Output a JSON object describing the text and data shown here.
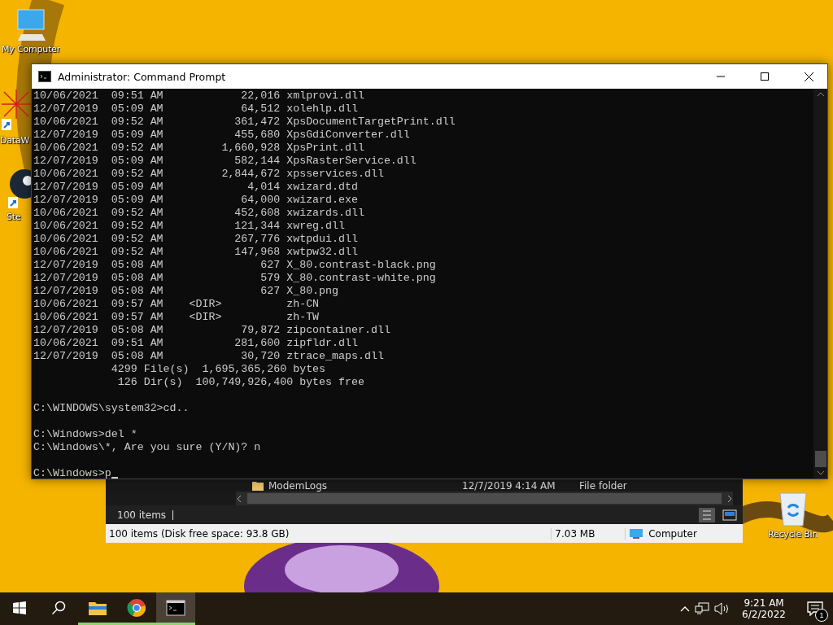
{
  "desktop": {
    "icons": [
      {
        "label": "My Computer",
        "kind": "computer"
      },
      {
        "label": "DataW",
        "kind": "spider"
      },
      {
        "label": "Ste",
        "kind": "steam"
      }
    ],
    "recycle_bin": {
      "label": "Recycle Bin"
    }
  },
  "explorer": {
    "row": {
      "name": "ModemLogs",
      "date": "12/7/2019 4:14 AM",
      "type": "File folder"
    },
    "item_count": "100 items",
    "status": {
      "summary": "100 items (Disk free space: 93.8 GB)",
      "size": "7.03 MB",
      "location": "Computer"
    }
  },
  "console": {
    "title": "Administrator: Command Prompt",
    "cursor": true,
    "blocks": [
      [
        "10/06/2021  09:51 AM            22,016 xmlprovi.dll",
        "12/07/2019  05:09 AM            64,512 xolehlp.dll",
        "10/06/2021  09:52 AM           361,472 XpsDocumentTargetPrint.dll",
        "12/07/2019  05:09 AM           455,680 XpsGdiConverter.dll",
        "10/06/2021  09:52 AM         1,660,928 XpsPrint.dll",
        "12/07/2019  05:09 AM           582,144 XpsRasterService.dll",
        "10/06/2021  09:52 AM         2,844,672 xpsservices.dll",
        "12/07/2019  05:09 AM             4,014 xwizard.dtd",
        "12/07/2019  05:09 AM            64,000 xwizard.exe",
        "10/06/2021  09:52 AM           452,608 xwizards.dll",
        "10/06/2021  09:52 AM           121,344 xwreg.dll",
        "10/06/2021  09:52 AM           267,776 xwtpdui.dll",
        "10/06/2021  09:52 AM           147,968 xwtpw32.dll",
        "12/07/2019  05:08 AM               627 X_80.contrast-black.png",
        "12/07/2019  05:08 AM               579 X_80.contrast-white.png",
        "12/07/2019  05:08 AM               627 X_80.png",
        "10/06/2021  09:57 AM    <DIR>          zh-CN",
        "10/06/2021  09:57 AM    <DIR>          zh-TW",
        "12/07/2019  05:08 AM            79,872 zipcontainer.dll",
        "10/06/2021  09:51 AM           281,600 zipfldr.dll",
        "12/07/2019  05:08 AM            30,720 ztrace_maps.dll",
        "            4299 File(s)  1,695,365,260 bytes",
        "             126 Dir(s)  100,749,926,400 bytes free"
      ],
      [
        "C:\\WINDOWS\\system32>cd.."
      ],
      [
        "C:\\Windows>del *",
        "C:\\Windows\\*, Are you sure (Y/N)? n"
      ],
      [
        "C:\\Windows>p"
      ]
    ]
  },
  "taskbar": {
    "apps": [
      {
        "kind": "folder",
        "active": false
      },
      {
        "kind": "chrome",
        "active": false
      },
      {
        "kind": "terminal",
        "active": true
      }
    ],
    "time": "9:21 AM",
    "date": "6/2/2022",
    "notifications": "1"
  }
}
